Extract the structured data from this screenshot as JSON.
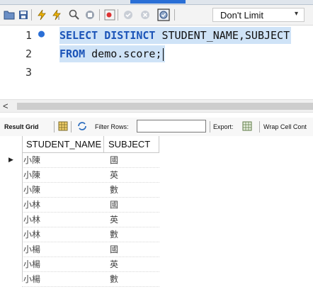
{
  "colors": {
    "keyword": "#1b54b8",
    "selection": "#cfe3f7",
    "gutter_dot": "#2a6fd6",
    "toolbar_bg": "#f3f3f3"
  },
  "toolbar": {
    "icons": [
      "open-folder-icon",
      "save-icon",
      "execute-icon",
      "execute-current-icon",
      "explain-icon",
      "stop-icon",
      "toggle-result-icon",
      "commit-icon",
      "rollback-icon",
      "autocommit-icon"
    ],
    "limit_value": "Don't Limit"
  },
  "editor": {
    "line_numbers": [
      "1",
      "2",
      "3"
    ],
    "line1": {
      "kw": "SELECT DISTINCT",
      "rest": " STUDENT_NAME,SUBJECT"
    },
    "line2": {
      "kw": "FROM",
      "rest": " demo.score;"
    }
  },
  "result_toolbar": {
    "result_grid_label": "Result Grid",
    "filter_label": "Filter Rows:",
    "filter_value": "",
    "export_label": "Export:",
    "wrap_label": "Wrap Cell Cont"
  },
  "grid": {
    "columns": [
      "STUDENT_NAME",
      "SUBJECT"
    ],
    "rows": [
      [
        "小陳",
        "國"
      ],
      [
        "小陳",
        "英"
      ],
      [
        "小陳",
        "數"
      ],
      [
        "小林",
        "國"
      ],
      [
        "小林",
        "英"
      ],
      [
        "小林",
        "數"
      ],
      [
        "小楊",
        "國"
      ],
      [
        "小楊",
        "英"
      ],
      [
        "小楊",
        "數"
      ]
    ],
    "current_row_indicator": "▶"
  }
}
